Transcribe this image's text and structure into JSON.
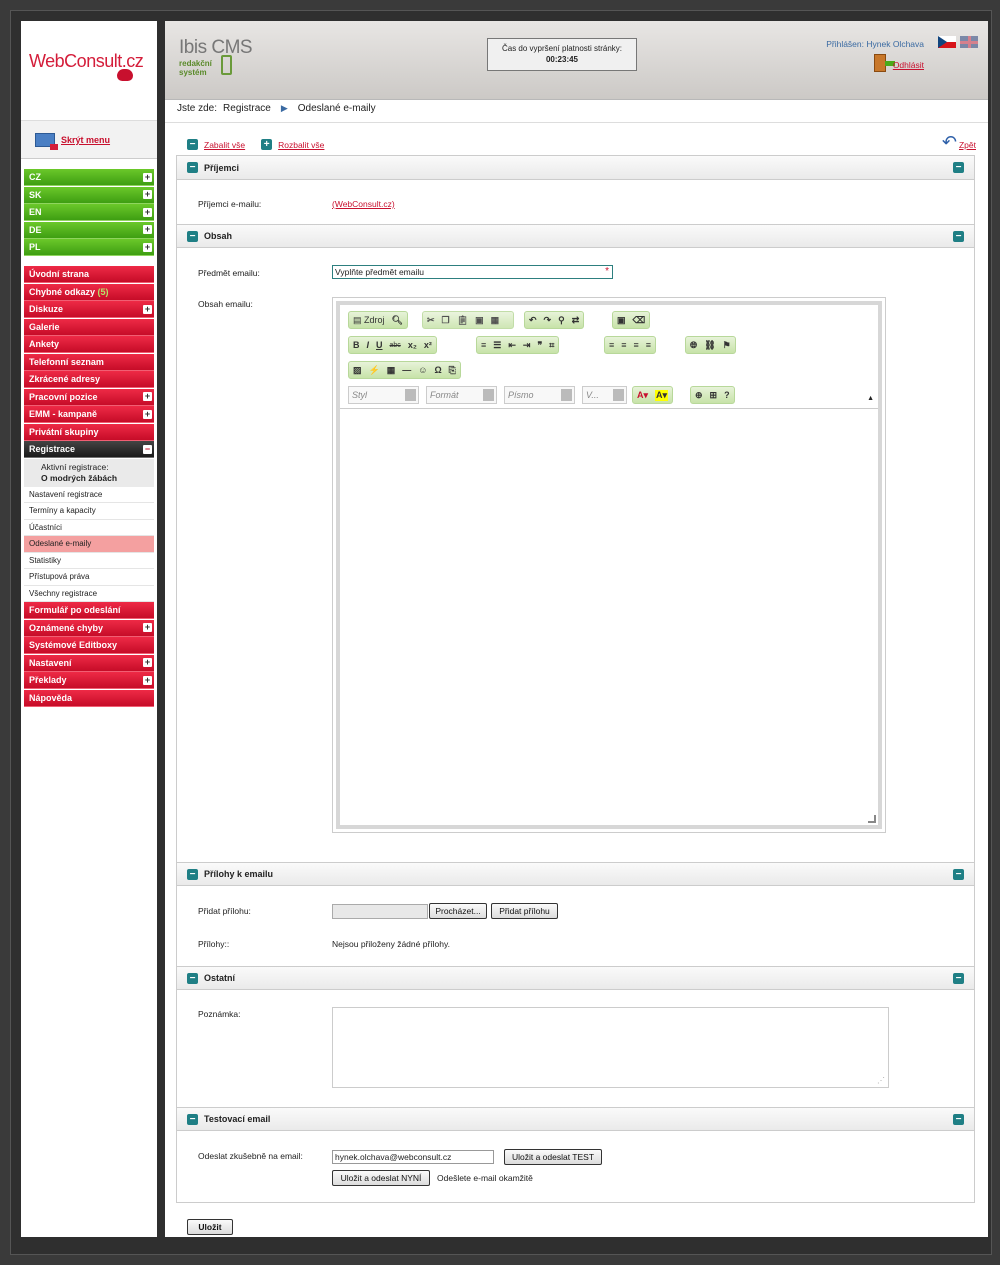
{
  "sidebar": {
    "logo_text": "WebConsult.cz",
    "hide_menu": "Skrýt menu",
    "languages": [
      "CZ",
      "SK",
      "EN",
      "DE",
      "PL"
    ],
    "menu": [
      {
        "label": "Úvodní strana",
        "plus": false
      },
      {
        "label": "Chybné odkazy",
        "badge": "(5)",
        "plus": false
      },
      {
        "label": "Diskuze",
        "plus": true
      },
      {
        "label": "Galerie",
        "plus": false
      },
      {
        "label": "Ankety",
        "plus": false
      },
      {
        "label": "Telefonní seznam",
        "plus": false
      },
      {
        "label": "Zkrácené adresy",
        "plus": false
      },
      {
        "label": "Pracovní pozice",
        "plus": true
      },
      {
        "label": "EMM - kampaně",
        "plus": true
      },
      {
        "label": "Privátní skupiny",
        "plus": false
      }
    ],
    "registrace": "Registrace",
    "active_reg_label": "Aktivní registrace:",
    "active_reg_value": "O modrých žábách",
    "sub": [
      "Nastavení registrace",
      "Termíny a kapacity",
      "Účastníci",
      "Odeslané e-maily",
      "Statistiky",
      "Přístupová práva",
      "Všechny registrace"
    ],
    "menu_after": [
      {
        "label": "Formulář po odeslání",
        "plus": false
      },
      {
        "label": "Oznámené chyby",
        "plus": true
      },
      {
        "label": "Systémové Editboxy",
        "plus": false
      },
      {
        "label": "Nastavení",
        "plus": true
      },
      {
        "label": "Překlady",
        "plus": true
      },
      {
        "label": "Nápověda",
        "plus": false
      }
    ]
  },
  "header": {
    "cms_name": "Ibis CMS",
    "cms_sub1": "redakční",
    "cms_sub2": "systém",
    "timer_label": "Čas do vypršení platnosti stránky:",
    "timer_value": "00:23:45",
    "login": "Přihlášen: Hynek Olchava",
    "logout": "Odhlásit"
  },
  "breadcrumb": {
    "prefix": "Jste zde:",
    "item1": "Registrace",
    "item2": "Odeslané e-maily"
  },
  "actions": {
    "collapse": "Zabalit vše",
    "expand": "Rozbalit vše",
    "back": "Zpět"
  },
  "prijemci": {
    "title": "Příjemci",
    "label": "Příjemci e-mailu:",
    "value": "(WebConsult.cz)"
  },
  "obsah": {
    "title": "Obsah",
    "subject_label": "Předmět emailu:",
    "subject_value": "Vyplňte předmět emailu",
    "body_label": "Obsah emailu:",
    "editor": {
      "source": "Zdroj",
      "style": "Styl",
      "format": "Formát",
      "font": "Písmo",
      "size": "V..."
    }
  },
  "prilohy": {
    "title": "Přílohy k emailu",
    "add_label": "Přidat přílohu:",
    "browse": "Procházet...",
    "add_btn": "Přidat přílohu",
    "list_label": "Přílohy::",
    "none": "Nejsou přiloženy žádné přílohy."
  },
  "ostatni": {
    "title": "Ostatní",
    "note_label": "Poznámka:"
  },
  "test": {
    "title": "Testovací email",
    "label": "Odeslat zkušebně na email:",
    "email": "hynek.olchava@webconsult.cz",
    "test_btn": "Uložit a odeslat TEST",
    "now_btn": "Uložit a odeslat NYNÍ",
    "now_text": "Odešlete e-mail okamžitě"
  },
  "save": "Uložit"
}
